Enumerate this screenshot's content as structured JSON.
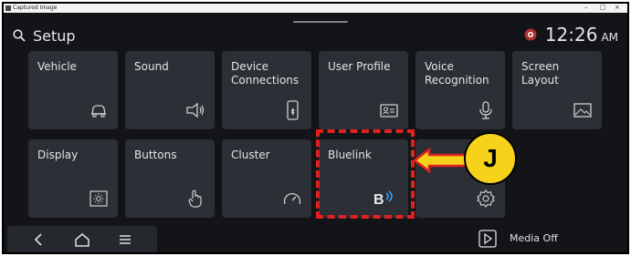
{
  "window": {
    "title": "Captured Image",
    "controls": [
      "–",
      "□",
      "×"
    ]
  },
  "header": {
    "title": "Setup",
    "time": "12:26",
    "ampm": "AM"
  },
  "tiles": [
    {
      "label": "Vehicle",
      "icon": "car-icon"
    },
    {
      "label": "Sound",
      "icon": "speaker-icon"
    },
    {
      "label": "Device Connections",
      "icon": "phone-bluetooth-icon"
    },
    {
      "label": "User Profile",
      "icon": "profile-card-icon"
    },
    {
      "label": "Voice Recognition",
      "icon": "microphone-icon"
    },
    {
      "label": "Screen Layout",
      "icon": "image-frame-icon"
    },
    {
      "label": "Display",
      "icon": "brightness-icon"
    },
    {
      "label": "Buttons",
      "icon": "hand-pointer-icon"
    },
    {
      "label": "Cluster",
      "icon": "gauge-icon"
    },
    {
      "label": "Bluelink",
      "icon": "bluelink-icon",
      "badge": "B"
    },
    {
      "label": "",
      "icon": "gear-icon"
    }
  ],
  "bottom": {
    "media": "Media Off"
  },
  "annotation": {
    "callout": "J"
  },
  "colors": {
    "highlight": "#e0211f",
    "callout": "#f7d21a",
    "tile": "#2c2f35",
    "background": "#121417"
  }
}
